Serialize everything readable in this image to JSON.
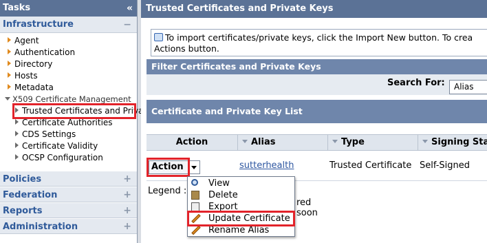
{
  "sidebar": {
    "title": "Tasks",
    "collapse_glyph": "«",
    "infrastructure": {
      "title": "Infrastructure",
      "toggle": "−",
      "items": [
        {
          "label": "Agent"
        },
        {
          "label": "Authentication"
        },
        {
          "label": "Directory"
        },
        {
          "label": "Hosts"
        },
        {
          "label": "Metadata"
        }
      ],
      "x509": {
        "label": "X509 Certificate Management",
        "items": [
          {
            "label": "Trusted Certificates and Private"
          },
          {
            "label": "Certificate Authorities"
          },
          {
            "label": "CDS Settings"
          },
          {
            "label": "Certificate Validity"
          },
          {
            "label": "OCSP Configuration"
          }
        ]
      }
    },
    "sections": [
      {
        "label": "Policies",
        "toggle": "+"
      },
      {
        "label": "Federation",
        "toggle": "+"
      },
      {
        "label": "Reports",
        "toggle": "+"
      },
      {
        "label": "Administration",
        "toggle": "+"
      }
    ]
  },
  "main": {
    "title": "Trusted Certificates and Private Keys",
    "info_line1": "To import certificates/private keys, click the Import New button. To crea",
    "info_line2": "Actions button.",
    "filter_title": "Filter Certificates and Private Keys",
    "search_label": "Search For:",
    "search_value": "Alias",
    "list_title": "Certificate and Private Key List",
    "columns": {
      "action": "Action",
      "alias": "Alias",
      "type": "Type",
      "signing": "Signing Sta"
    },
    "row": {
      "action_label": "Action",
      "alias": "sutterhealth",
      "type": "Trusted Certificate",
      "signing": "Self-Signed"
    },
    "legend_label": "Legend :",
    "legend_partial_1": "red",
    "legend_partial_2": "soon"
  },
  "menu": {
    "items": [
      {
        "label": "View",
        "icon": "magnifier-icon"
      },
      {
        "label": "Delete",
        "icon": "trash-icon"
      },
      {
        "label": "Export",
        "icon": "export-icon"
      },
      {
        "label": "Update Certificate",
        "icon": "pencil-icon"
      },
      {
        "label": "Rename Alias",
        "icon": "pencil-icon"
      }
    ]
  },
  "colors": {
    "header_bg": "#5b7296",
    "section_bar": "#6f86ab",
    "highlight": "#e2232a",
    "link": "#2d56a0"
  }
}
